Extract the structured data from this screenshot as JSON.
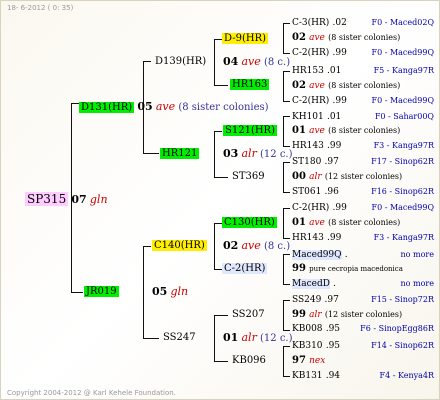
{
  "date": "18- 6-2012 ( 0: 35)",
  "copyright": "Copyright 2004-2012 @ Karl Kehele Foundation.",
  "root": {
    "name": "SP315",
    "num": "07",
    "quality": "gln"
  },
  "l1": [
    {
      "name": "D131(HR)",
      "num": "05",
      "quality": "ave",
      "sisters": "(8 sister colonies)"
    },
    {
      "name": "JR019",
      "num": "05",
      "quality": "gln"
    }
  ],
  "l2": [
    {
      "name": "D139(HR)",
      "num": "04",
      "quality": "ave",
      "sisters": "(8 c.)"
    },
    {
      "name": "HR121",
      "num": "03",
      "quality": "alr",
      "sisters": "(12 c.)"
    },
    {
      "name": "C140(HR)",
      "num": "02",
      "quality": "ave",
      "sisters": "(8 c.)"
    },
    {
      "name": "SS247",
      "num": "01",
      "quality": "alr",
      "sisters": "(12 c.)"
    }
  ],
  "l3": [
    {
      "name": "D-9(HR)",
      "num": "02",
      "quality": "ave",
      "sisters": "(8 sister colonies)"
    },
    {
      "name": "HR163",
      "num": "02",
      "quality": "ave",
      "sisters": "(8 sister colonies)"
    },
    {
      "name": "S121(HR)",
      "num": "01",
      "quality": "ave",
      "sisters": "(8 sister colonies)"
    },
    {
      "name": "ST369",
      "num": "00",
      "quality": "alr",
      "sisters": "(12 sister colonies)"
    },
    {
      "name": "C130(HR)",
      "num": "01",
      "quality": "ave",
      "sisters": "(8 sister colonies)"
    },
    {
      "name": "C-2(HR)",
      "num": "99",
      "quality": "",
      "sisters": "pure cecropia macedonica"
    },
    {
      "name": "SS207",
      "num": "99",
      "quality": "alr",
      "sisters": "(12 sister colonies)"
    },
    {
      "name": "KB096",
      "num": "97",
      "quality": "nex",
      "sisters": ""
    }
  ],
  "l4": [
    {
      "name": "C-3(HR)",
      "year": ".02",
      "src": "F0 - Maced02Q"
    },
    {
      "name": "C-2(HR)",
      "year": ".99",
      "src": "F0 - Maced99Q"
    },
    {
      "name": "HR153",
      "year": ".01",
      "src": "F5 - Kanga97R"
    },
    {
      "name": "C-2(HR)",
      "year": ".99",
      "src": "F0 - Maced99Q"
    },
    {
      "name": "KH101",
      "year": ".01",
      "src": "F0 - Sahar00Q"
    },
    {
      "name": "HR143",
      "year": ".99",
      "src": "F3 - Kanga97R"
    },
    {
      "name": "ST180",
      "year": ".97",
      "src": "F17 - Sinop62R"
    },
    {
      "name": "ST061",
      "year": ".96",
      "src": "F16 - Sinop62R"
    },
    {
      "name": "C-2(HR)",
      "year": ".99",
      "src": "F0 - Maced99Q"
    },
    {
      "name": "HR143",
      "year": ".99",
      "src": "F3 - Kanga97R"
    },
    {
      "name": "Maced99Q",
      "year": ".",
      "src": "no more"
    },
    {
      "name": "MacedD",
      "year": ".",
      "src": "no more"
    },
    {
      "name": "SS249",
      "year": ".97",
      "src": "F15 - Sinop72R"
    },
    {
      "name": "KB008",
      "year": ".95",
      "src": "F6 - SinopEgg86R"
    },
    {
      "name": "KB310",
      "year": ".95",
      "src": "F14 - Sinop62R"
    },
    {
      "name": "KB131",
      "year": ".94",
      "src": "F4 - Kenya4R"
    }
  ]
}
